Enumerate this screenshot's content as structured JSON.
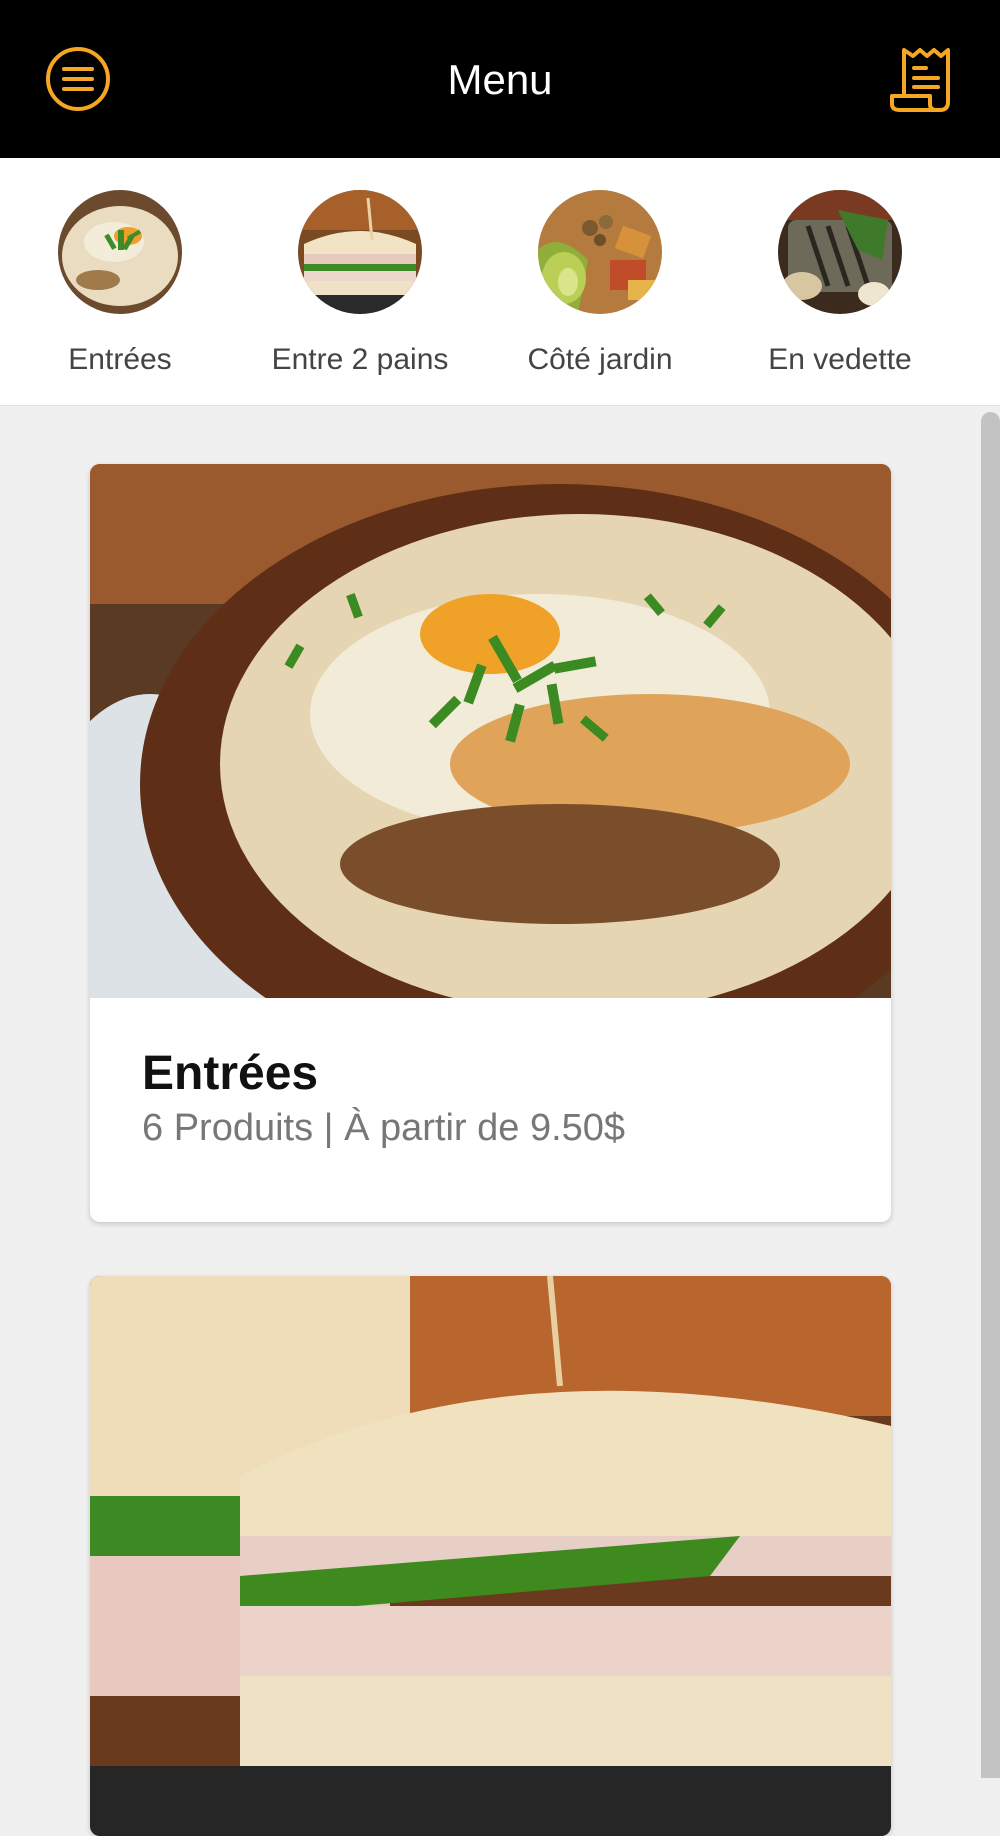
{
  "header": {
    "title": "Menu",
    "menu_icon": "hamburger-circle-icon",
    "orders_icon": "receipt-icon",
    "accent_color": "#F5A623"
  },
  "categories": [
    {
      "label": "Entrées",
      "thumb": "gratin-dish-photo"
    },
    {
      "label": "Entre 2 pains",
      "thumb": "sandwich-photo"
    },
    {
      "label": "Côté jardin",
      "thumb": "salad-bowl-photo"
    },
    {
      "label": "En vedette",
      "thumb": "grilled-dish-photo"
    }
  ],
  "cards": [
    {
      "title": "Entrées",
      "subtitle": "6 Produits | À partir de 9.50$",
      "photo": "gratin-dish-photo"
    },
    {
      "photo": "sandwich-photo"
    }
  ]
}
